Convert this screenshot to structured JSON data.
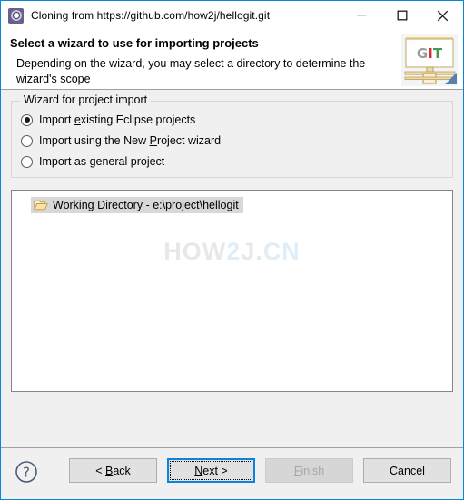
{
  "window": {
    "title": "Cloning from https://github.com/how2j/hellogit.git",
    "icon": "eclipse-git-icon",
    "controls": {
      "minimize": "minimize-icon",
      "maximize": "maximize-icon",
      "close": "close-icon"
    }
  },
  "header": {
    "title": "Select a wizard to use for importing projects",
    "description": "Depending on the wizard, you may select a directory to determine the wizard's scope",
    "logo": {
      "g": "G",
      "i": "I",
      "t": "T"
    }
  },
  "group": {
    "legend": "Wizard for project import",
    "options": [
      {
        "label_before": "Import ",
        "mnemonic": "e",
        "label_after": "xisting Eclipse projects",
        "selected": true
      },
      {
        "label_before": "Import using the New ",
        "mnemonic": "P",
        "label_after": "roject wizard",
        "selected": false
      },
      {
        "label_before": "Import as ",
        "mnemonic": "g",
        "label_after": "eneral project",
        "selected": false
      }
    ]
  },
  "tree": {
    "items": [
      {
        "icon": "open-folder-icon",
        "label": "Working Directory - e:\\project\\hellogit",
        "selected": true
      }
    ]
  },
  "watermark": {
    "part1": "HOW",
    "part2": "2",
    "part3": "J.",
    "part4": "CN"
  },
  "footer": {
    "help": "help-icon",
    "buttons": [
      {
        "name": "back",
        "before": "< ",
        "mnemonic": "B",
        "after": "ack",
        "state": "enabled"
      },
      {
        "name": "next",
        "before": "",
        "mnemonic": "N",
        "after": "ext >",
        "state": "focused"
      },
      {
        "name": "finish",
        "before": "",
        "mnemonic": "F",
        "after": "inish",
        "state": "disabled"
      },
      {
        "name": "cancel",
        "before": "Cancel",
        "mnemonic": "",
        "after": "",
        "state": "enabled"
      }
    ]
  },
  "colors": {
    "accent": "#0a84d8",
    "dialog_bg": "#f0f0f0",
    "panel_bg": "#ffffff",
    "selection": "#d8d8d8"
  }
}
